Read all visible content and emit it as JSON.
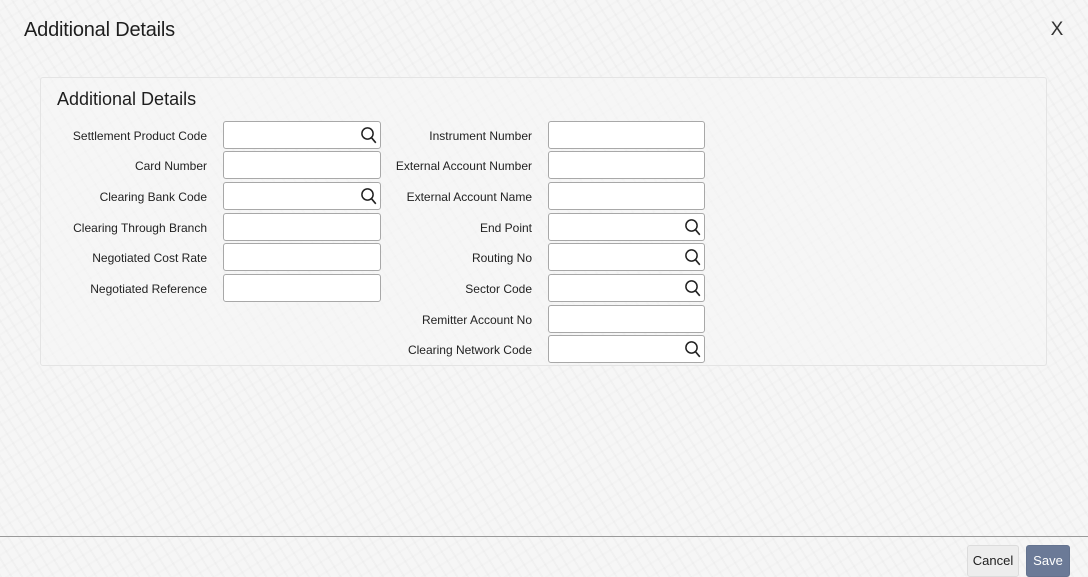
{
  "dialog": {
    "title": "Additional Details",
    "close_label": "X"
  },
  "section": {
    "title": "Additional Details"
  },
  "left_fields": [
    {
      "label": "Settlement Product Code",
      "value": "",
      "lookup": true
    },
    {
      "label": "Card Number",
      "value": "",
      "lookup": false
    },
    {
      "label": "Clearing Bank Code",
      "value": "",
      "lookup": true
    },
    {
      "label": "Clearing Through Branch",
      "value": "",
      "lookup": false
    },
    {
      "label": "Negotiated Cost Rate",
      "value": "",
      "lookup": false
    },
    {
      "label": "Negotiated Reference",
      "value": "",
      "lookup": false
    }
  ],
  "right_fields": [
    {
      "label": "Instrument Number",
      "value": "",
      "lookup": false
    },
    {
      "label": "External Account Number",
      "value": "",
      "lookup": false
    },
    {
      "label": "External Account Name",
      "value": "",
      "lookup": false
    },
    {
      "label": "End Point",
      "value": "",
      "lookup": true
    },
    {
      "label": "Routing No",
      "value": "",
      "lookup": true
    },
    {
      "label": "Sector Code",
      "value": "",
      "lookup": true
    },
    {
      "label": "Remitter Account No",
      "value": "",
      "lookup": false
    },
    {
      "label": "Clearing Network Code",
      "value": "",
      "lookup": true
    }
  ],
  "footer": {
    "cancel_label": "Cancel",
    "save_label": "Save"
  },
  "icons": {
    "lookup": "search-icon",
    "close": "close-icon"
  },
  "colors": {
    "save_button": "#6b7a97",
    "cancel_button": "#ededed",
    "field_border": "#a8a8a8"
  }
}
